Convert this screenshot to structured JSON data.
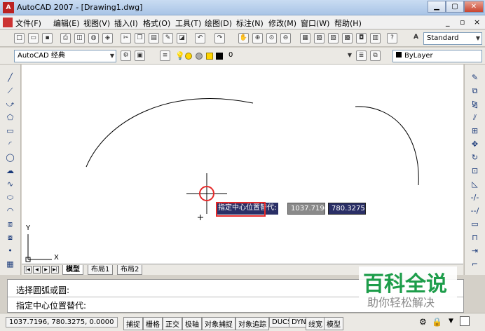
{
  "window": {
    "title": "AutoCAD 2007 - [Drawing1.dwg]",
    "icon": "autocad-app-icon",
    "controls": [
      "▁",
      "▢",
      "✕"
    ]
  },
  "menubar": {
    "items": [
      "文件(F)",
      "编辑(E)",
      "视图(V)",
      "插入(I)",
      "格式(O)",
      "工具(T)",
      "绘图(D)",
      "标注(N)",
      "修改(M)",
      "窗口(W)",
      "帮助(H)"
    ],
    "doc_controls": [
      "_",
      "▫",
      "×"
    ]
  },
  "toolbar1": {
    "text_style_combo": "Standard"
  },
  "toolbar2": {
    "workspace_combo": "AutoCAD 经典",
    "layer_combo": "0",
    "color_combo": "ByLayer"
  },
  "left_toolbar": {
    "icons": [
      "line-icon",
      "construction-line-icon",
      "polyline-icon",
      "polygon-icon",
      "rectangle-icon",
      "arc-icon",
      "circle-icon",
      "revision-cloud-icon",
      "spline-icon",
      "ellipse-icon",
      "ellipse-arc-icon",
      "insert-block-icon",
      "make-block-icon",
      "point-icon",
      "hatch-icon"
    ]
  },
  "right_toolbar": {
    "icons": [
      "erase-icon",
      "copy-icon",
      "mirror-icon",
      "offset-icon",
      "array-icon",
      "move-icon",
      "rotate-icon",
      "scale-icon",
      "stretch-icon",
      "trim-icon",
      "extend-icon",
      "break-icon",
      "join-icon",
      "chamfer-icon",
      "fillet-icon"
    ]
  },
  "ucs": {
    "x_label": "X",
    "y_label": "Y"
  },
  "dynamic_input": {
    "prompt": "指定中心位置替代:",
    "x_value": "1037.7196",
    "y_value": "780.3275"
  },
  "layout_tabs": {
    "tabs": [
      "模型",
      "布局1",
      "布局2"
    ],
    "active": "模型"
  },
  "command_line": {
    "lines": [
      "选择圆弧或圆:",
      "指定中心位置替代:"
    ]
  },
  "statusbar": {
    "coordinates": "1037.7196, 780.3275, 0.0000",
    "buttons": [
      "捕捉",
      "栅格",
      "正交",
      "极轴",
      "对象捕捉",
      "对象追踪",
      "DUCS",
      "DYN",
      "线宽",
      "模型"
    ]
  },
  "watermark": {
    "main": "百科全说",
    "sub": "助你轻松解决"
  },
  "colors": {
    "dyn_prompt_bg": "#2a2f66",
    "highlight": "#e52929",
    "watermark_green": "#1d9d4a"
  }
}
